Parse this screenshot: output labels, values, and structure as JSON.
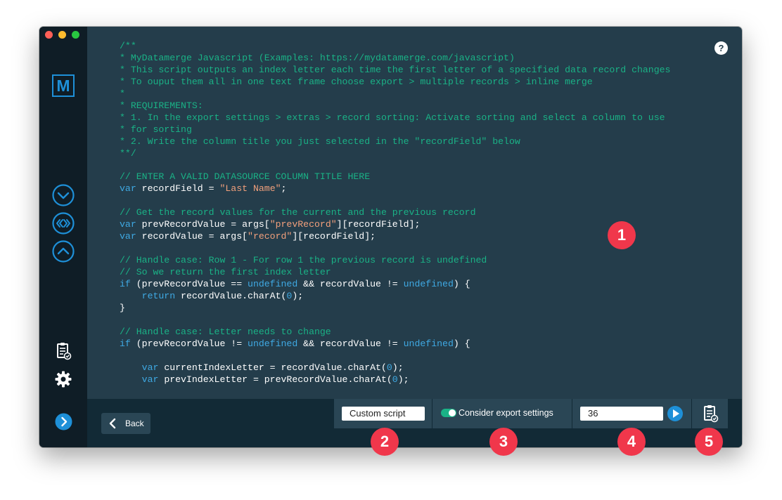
{
  "app": {
    "logo_letter": "M"
  },
  "editor": {
    "help_label": "?",
    "code_lines": [
      [
        {
          "t": "c",
          "v": "/**"
        }
      ],
      [
        {
          "t": "c",
          "v": "* MyDatamerge Javascript (Examples: https://mydatamerge.com/javascript)"
        }
      ],
      [
        {
          "t": "c",
          "v": "* This script outputs an index letter each time the first letter of a specified data record changes"
        }
      ],
      [
        {
          "t": "c",
          "v": "* To ouput them all in one text frame choose export > multiple records > inline merge"
        }
      ],
      [
        {
          "t": "c",
          "v": "*"
        }
      ],
      [
        {
          "t": "c",
          "v": "* REQUIREMENTS:"
        }
      ],
      [
        {
          "t": "c",
          "v": "* 1. In the export settings > extras > record sorting: Activate sorting and select a column to use"
        }
      ],
      [
        {
          "t": "c",
          "v": "* for sorting"
        }
      ],
      [
        {
          "t": "c",
          "v": "* 2. Write the column title you just selected in the \"recordField\" below"
        }
      ],
      [
        {
          "t": "c",
          "v": "**/"
        }
      ],
      [],
      [
        {
          "t": "c",
          "v": "// ENTER A VALID DATASOURCE COLUMN TITLE HERE"
        }
      ],
      [
        {
          "t": "k",
          "v": "var"
        },
        {
          "t": "p",
          "v": " recordField = "
        },
        {
          "t": "s",
          "v": "\"Last Name\""
        },
        {
          "t": "p",
          "v": ";"
        }
      ],
      [],
      [
        {
          "t": "c",
          "v": "// Get the record values for the current and the previous record"
        }
      ],
      [
        {
          "t": "k",
          "v": "var"
        },
        {
          "t": "p",
          "v": " prevRecordValue = args["
        },
        {
          "t": "s",
          "v": "\"prevRecord\""
        },
        {
          "t": "p",
          "v": "][recordField];"
        }
      ],
      [
        {
          "t": "k",
          "v": "var"
        },
        {
          "t": "p",
          "v": " recordValue = args["
        },
        {
          "t": "s",
          "v": "\"record\""
        },
        {
          "t": "p",
          "v": "][recordField];"
        }
      ],
      [],
      [
        {
          "t": "c",
          "v": "// Handle case: Row 1 - For row 1 the previous record is undefined"
        }
      ],
      [
        {
          "t": "c",
          "v": "// So we return the first index letter"
        }
      ],
      [
        {
          "t": "k",
          "v": "if"
        },
        {
          "t": "p",
          "v": " (prevRecordValue == "
        },
        {
          "t": "k",
          "v": "undefined"
        },
        {
          "t": "p",
          "v": " && recordValue != "
        },
        {
          "t": "k",
          "v": "undefined"
        },
        {
          "t": "p",
          "v": ") {"
        }
      ],
      [
        {
          "t": "p",
          "v": "    "
        },
        {
          "t": "k",
          "v": "return"
        },
        {
          "t": "p",
          "v": " recordValue.charAt("
        },
        {
          "t": "n",
          "v": "0"
        },
        {
          "t": "p",
          "v": ");"
        }
      ],
      [
        {
          "t": "p",
          "v": "}"
        }
      ],
      [],
      [
        {
          "t": "c",
          "v": "// Handle case: Letter needs to change"
        }
      ],
      [
        {
          "t": "k",
          "v": "if"
        },
        {
          "t": "p",
          "v": " (prevRecordValue != "
        },
        {
          "t": "k",
          "v": "undefined"
        },
        {
          "t": "p",
          "v": " && recordValue != "
        },
        {
          "t": "k",
          "v": "undefined"
        },
        {
          "t": "p",
          "v": ") {"
        }
      ],
      [],
      [
        {
          "t": "p",
          "v": "    "
        },
        {
          "t": "k",
          "v": "var"
        },
        {
          "t": "p",
          "v": " currentIndexLetter = recordValue.charAt("
        },
        {
          "t": "n",
          "v": "0"
        },
        {
          "t": "p",
          "v": ");"
        }
      ],
      [
        {
          "t": "p",
          "v": "    "
        },
        {
          "t": "k",
          "v": "var"
        },
        {
          "t": "p",
          "v": " prevIndexLetter = prevRecordValue.charAt("
        },
        {
          "t": "n",
          "v": "0"
        },
        {
          "t": "p",
          "v": ");"
        }
      ]
    ]
  },
  "footer": {
    "back_label": "Back",
    "script_select_value": "Custom script",
    "consider_export_label": "Consider export settings",
    "consider_export_enabled": true,
    "record_number_value": "36"
  },
  "annotations": {
    "badge_1": "1",
    "badge_2": "2",
    "badge_3": "3",
    "badge_4": "4",
    "badge_5": "5"
  },
  "icons": {
    "sidebar": [
      "chevron-down-circle-icon",
      "double-chevron-circle-icon",
      "chevron-up-circle-icon",
      "clipboard-check-icon",
      "gear-icon",
      "chevron-right-circle-icon"
    ],
    "footer": [
      "chevron-left-icon",
      "play-icon",
      "clipboard-check-icon"
    ]
  },
  "colors": {
    "accent_blue": "#1e90d8",
    "comment_green": "#1ab286",
    "string_orange": "#f2a07c",
    "badge_red": "#f0374b",
    "editor_bg": "#243d4b",
    "sidebar_bg": "#0f1d26"
  }
}
